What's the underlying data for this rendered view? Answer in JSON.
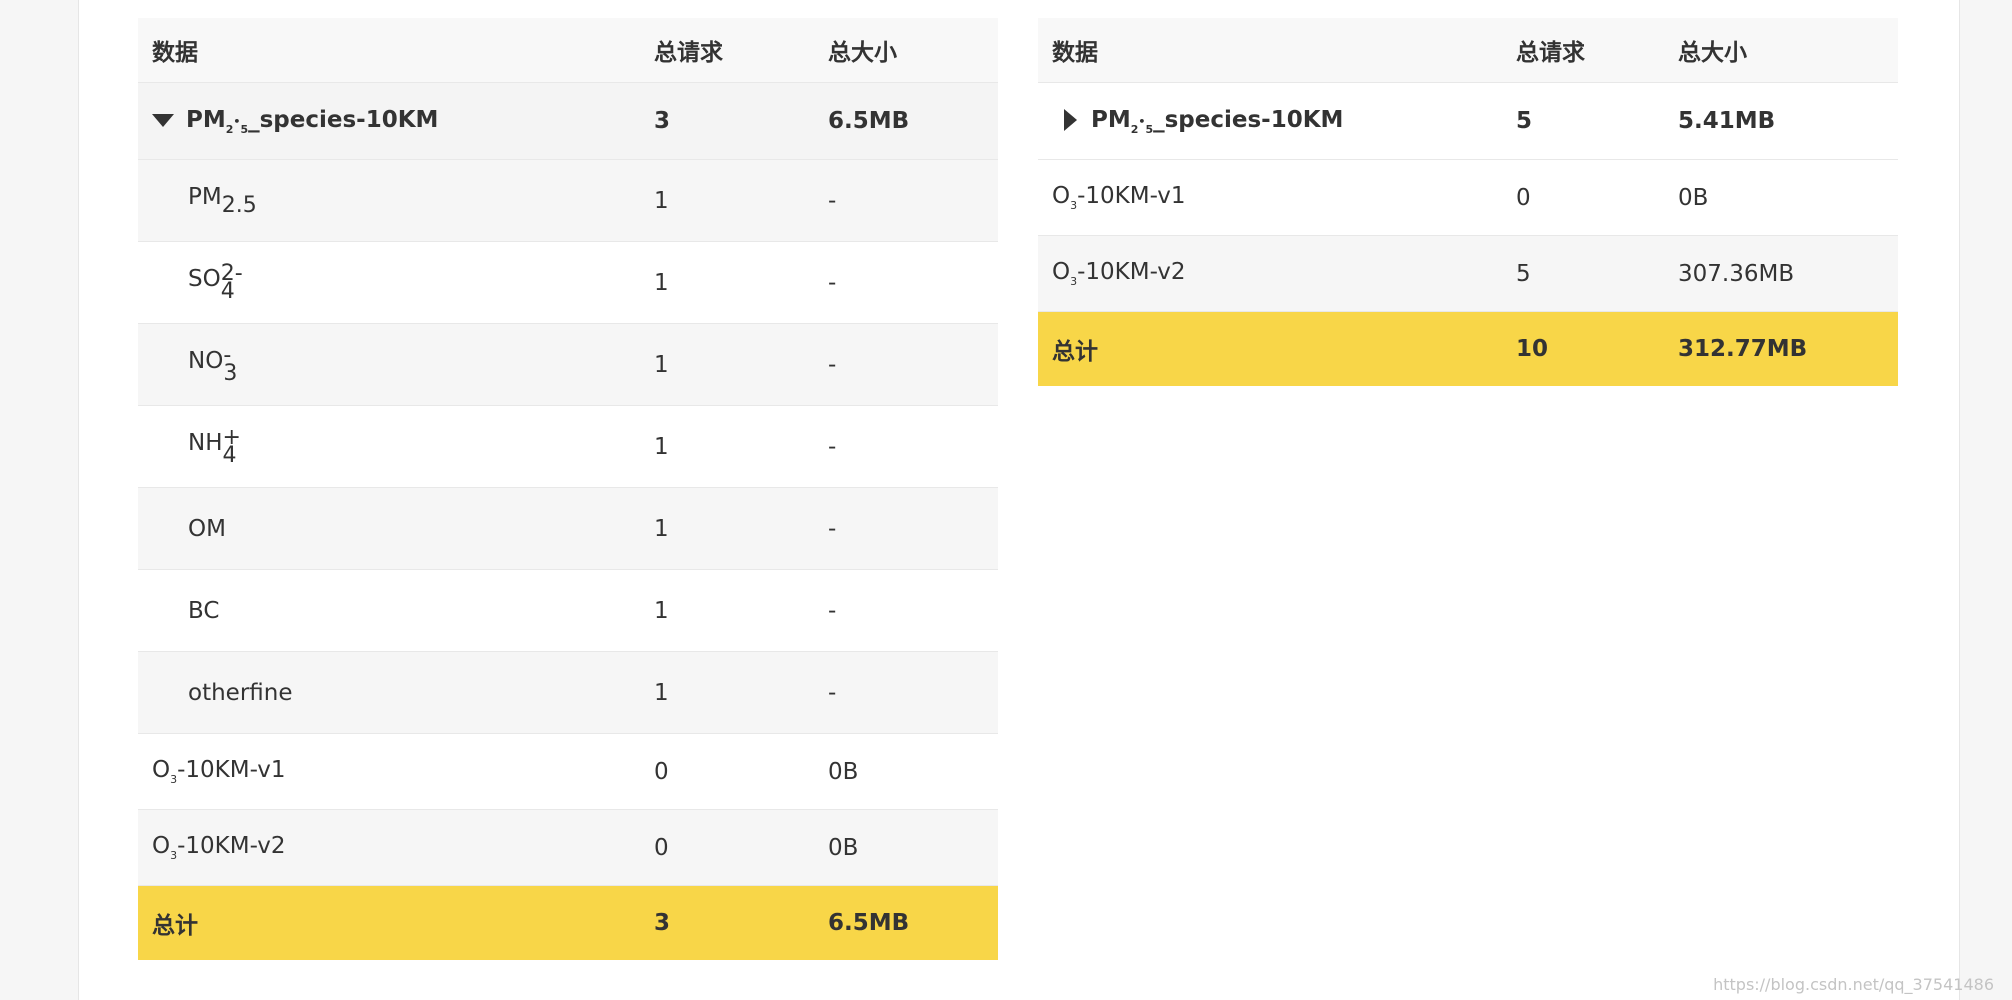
{
  "columns": {
    "data": "数据",
    "requests": "总请求",
    "size": "总大小"
  },
  "left_table": {
    "group": {
      "name_prefix": "PM",
      "name_sub1": "2",
      "name_dot": "•",
      "name_sub2": "5",
      "name_suffix": "_species-10KM",
      "requests": "3",
      "size": "6.5MB"
    },
    "children": [
      {
        "base": "PM",
        "sub": "2.5",
        "sup": "",
        "requests": "1",
        "size": "-"
      },
      {
        "base": "SO",
        "sub": "4",
        "sup": "2-",
        "requests": "1",
        "size": "-"
      },
      {
        "base": "NO",
        "sub": "3",
        "sup": "-",
        "requests": "1",
        "size": "-"
      },
      {
        "base": "NH",
        "sub": "4",
        "sup": "+",
        "requests": "1",
        "size": "-"
      },
      {
        "base": "OM",
        "sub": "",
        "sup": "",
        "requests": "1",
        "size": "-"
      },
      {
        "base": "BC",
        "sub": "",
        "sup": "",
        "requests": "1",
        "size": "-"
      },
      {
        "base": "otherfine",
        "sub": "",
        "sup": "",
        "requests": "1",
        "size": "-"
      }
    ],
    "rows": [
      {
        "prefix": "O",
        "sub": "3",
        "suffix": "-10KM-v1",
        "requests": "0",
        "size": "0B"
      },
      {
        "prefix": "O",
        "sub": "3",
        "suffix": "-10KM-v2",
        "requests": "0",
        "size": "0B"
      }
    ],
    "total": {
      "label": "总计",
      "requests": "3",
      "size": "6.5MB"
    }
  },
  "right_table": {
    "group": {
      "name_prefix": "PM",
      "name_sub1": "2",
      "name_dot": "•",
      "name_sub2": "5",
      "name_suffix": "_species-10KM",
      "requests": "5",
      "size": "5.41MB"
    },
    "rows": [
      {
        "prefix": "O",
        "sub": "3",
        "suffix": "-10KM-v1",
        "requests": "0",
        "size": "0B"
      },
      {
        "prefix": "O",
        "sub": "3",
        "suffix": "-10KM-v2",
        "requests": "5",
        "size": "307.36MB"
      }
    ],
    "total": {
      "label": "总计",
      "requests": "10",
      "size": "312.77MB"
    }
  },
  "watermark": "https://blog.csdn.net/qq_37541486",
  "colors": {
    "total_row": "#f8d648",
    "stripe": "#f6f6f6",
    "text": "#333333"
  }
}
